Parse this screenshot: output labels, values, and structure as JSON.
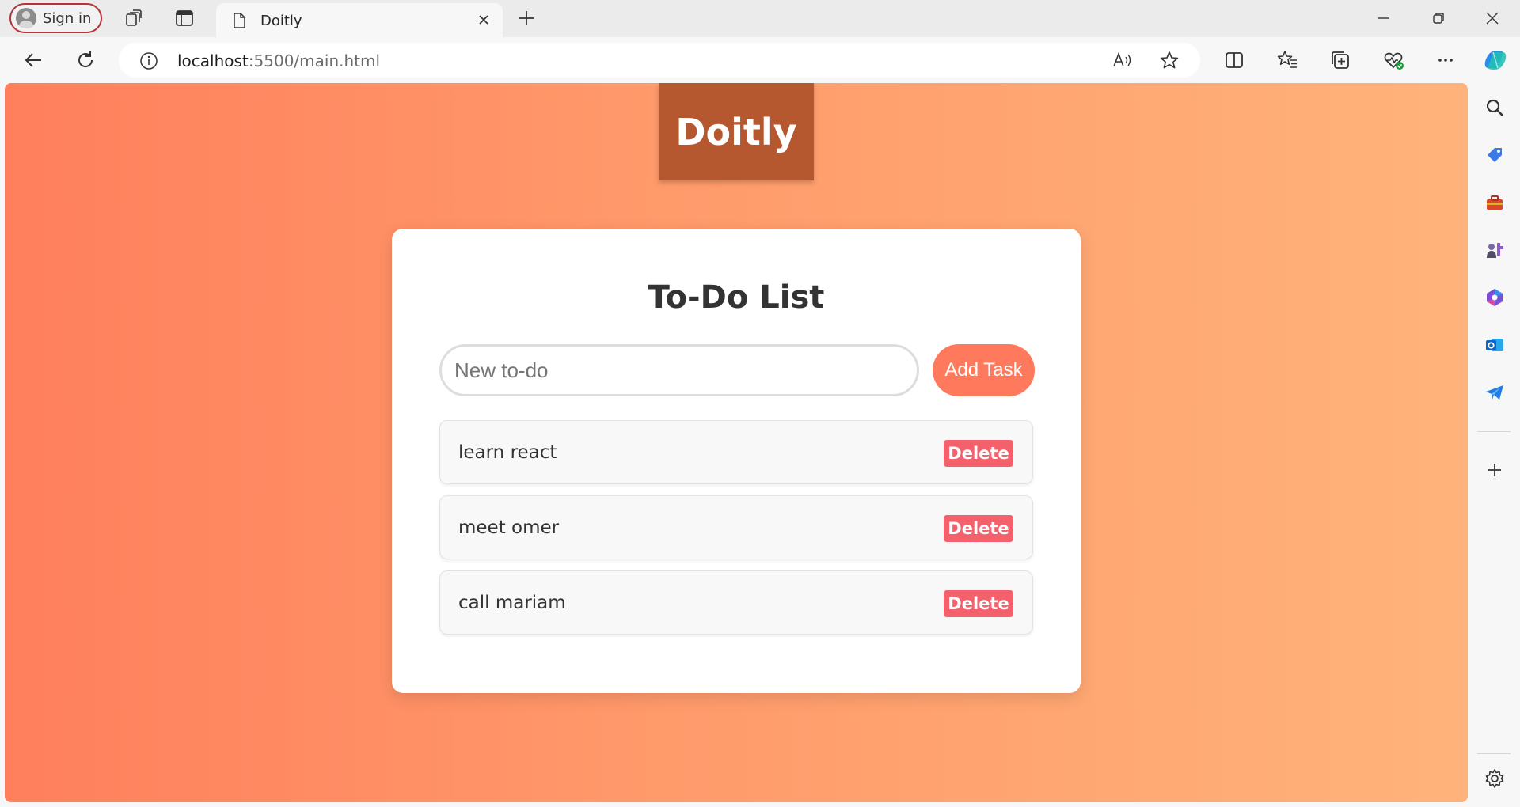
{
  "browser": {
    "signin_label": "Sign in",
    "tab_title": "Doitly",
    "url_host": "localhost",
    "url_path": ":5500/main.html"
  },
  "page": {
    "brand": "Doitly",
    "card_title": "To-Do List",
    "input_placeholder": "New to-do",
    "input_value": "",
    "add_button_label": "Add Task",
    "delete_label": "Delete",
    "todos": [
      {
        "text": "learn react"
      },
      {
        "text": "meet omer"
      },
      {
        "text": "call mariam"
      }
    ]
  },
  "colors": {
    "gradient_start": "#ff7f5c",
    "gradient_end": "#ffb37a",
    "brand_bg": "#b55830",
    "add_button": "#ff7a5c",
    "delete_button": "#f4606b"
  },
  "icons": {
    "tabstrip": [
      "profile-avatar-icon",
      "workspaces-icon",
      "vertical-tabs-icon",
      "page-icon",
      "close-tab-icon",
      "new-tab-icon",
      "minimize-icon",
      "restore-icon",
      "close-window-icon"
    ],
    "toolbar": [
      "back-icon",
      "refresh-icon",
      "site-info-icon",
      "read-aloud-icon",
      "favorite-star-icon",
      "split-screen-icon",
      "favorites-icon",
      "collections-icon",
      "browser-essentials-icon",
      "more-icon",
      "copilot-icon"
    ],
    "sidebar": [
      "search-icon",
      "shopping-icon",
      "tools-icon",
      "games-icon",
      "microsoft365-icon",
      "outlook-icon",
      "telegram-icon",
      "add-icon",
      "settings-icon"
    ]
  }
}
